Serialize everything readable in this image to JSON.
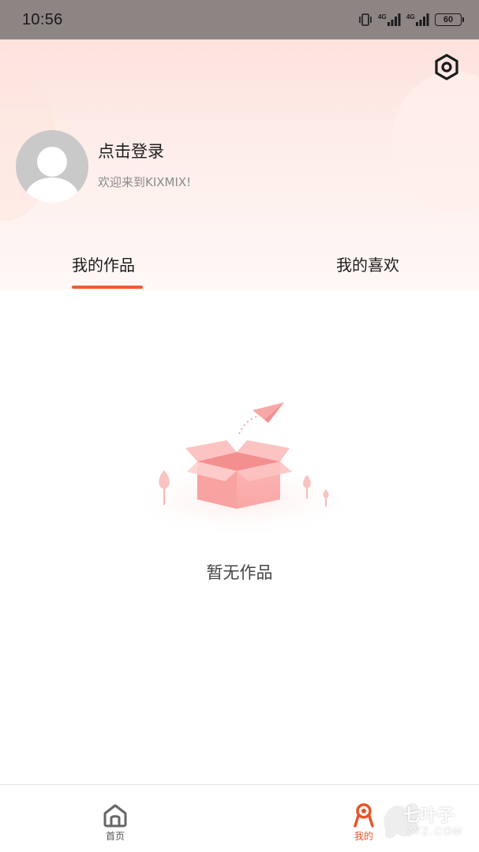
{
  "status_bar": {
    "time": "10:56",
    "battery": "60",
    "icons": [
      "vibrate-icon",
      "signal-4g-icon",
      "signal-4g-icon",
      "battery-icon"
    ]
  },
  "header": {
    "login_title": "点击登录",
    "welcome": "欢迎来到KIXMIX!",
    "settings_icon": "settings-hexagon-icon"
  },
  "tabs": [
    {
      "label": "我的作品",
      "active": true
    },
    {
      "label": "我的喜欢",
      "active": false
    }
  ],
  "empty_state": {
    "text": "暂无作品"
  },
  "bottom_nav": {
    "items": [
      {
        "label": "首页",
        "icon": "home-icon",
        "active": false
      },
      {
        "label": "我的",
        "icon": "mine-icon",
        "active": true
      }
    ]
  },
  "watermark": {
    "title": "七叶子",
    "subtitle": "7YZ.COM"
  },
  "colors": {
    "accent": "#ef5a2e",
    "status_bar": "#8d8584",
    "header_top": "#fde2dd"
  }
}
